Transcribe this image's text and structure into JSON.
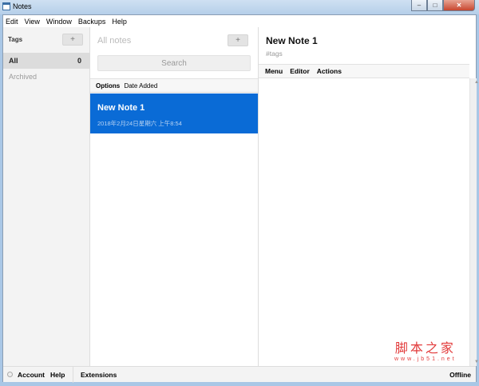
{
  "window": {
    "title": "Notes",
    "minimize": "–",
    "maximize": "□",
    "close": "✕"
  },
  "menu": [
    "Edit",
    "View",
    "Window",
    "Backups",
    "Help"
  ],
  "sidebar": {
    "heading": "Tags",
    "add": "+",
    "items": [
      {
        "label": "All",
        "count": "0"
      },
      {
        "label": "Archived"
      }
    ]
  },
  "notes": {
    "heading": "All notes",
    "add": "+",
    "search_placeholder": "Search",
    "options_label": "Options",
    "sort_label": "Date Added",
    "items": [
      {
        "title": "New Note 1",
        "date": "2018年2月24日星期六 上午8:54"
      }
    ]
  },
  "editor": {
    "title": "New Note 1",
    "tags": "#tags",
    "toolbar": [
      "Menu",
      "Editor",
      "Actions"
    ]
  },
  "footer": {
    "account": "Account",
    "help": "Help",
    "extensions": "Extensions",
    "status": "Offline"
  },
  "watermark": {
    "text": "脚本之家",
    "url": "www.jb51.net"
  },
  "colors": {
    "accent": "#0a6bd6"
  }
}
